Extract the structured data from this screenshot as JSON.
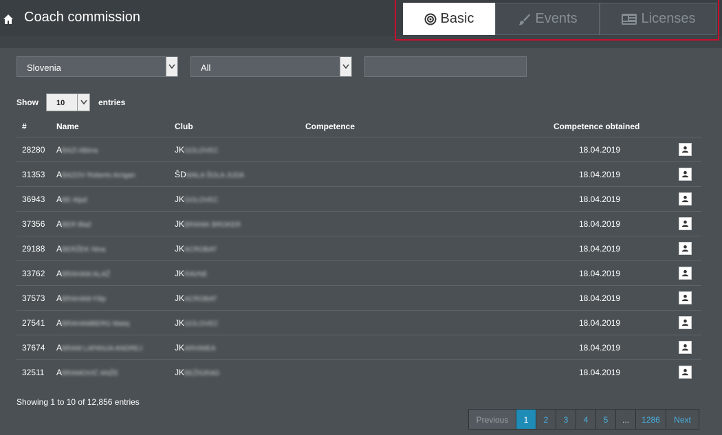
{
  "header": {
    "title": "Coach commission",
    "tabs": [
      {
        "label": "Basic",
        "active": true
      },
      {
        "label": "Events",
        "active": false
      },
      {
        "label": "Licenses",
        "active": false
      }
    ]
  },
  "filters": {
    "country": "Slovenia",
    "category": "All",
    "search_value": ""
  },
  "length": {
    "show_label": "Show",
    "value": "10",
    "entries_label": "entries"
  },
  "table": {
    "columns": [
      "#",
      "Name",
      "Club",
      "Competence",
      "Competence obtained"
    ],
    "rows": [
      {
        "id": "28280",
        "name_initial": "A",
        "name_rest": "BAZI Albina",
        "club_initial": "JK",
        "club_rest": "GOLOVEC",
        "date": "18.04.2019"
      },
      {
        "id": "31353",
        "name_initial": "A",
        "name_rest": "BAZOV Roberto Arrigan",
        "club_initial": "ŠD",
        "club_rest": "MALA ŠOLA JUDA",
        "date": "18.04.2019"
      },
      {
        "id": "36943",
        "name_initial": "A",
        "name_rest": "BE Aljaž",
        "club_initial": "JK",
        "club_rest": "GOLOVEC",
        "date": "18.04.2019"
      },
      {
        "id": "37356",
        "name_initial": "A",
        "name_rest": "BER Blaž",
        "club_initial": "JK",
        "club_rest": "BRANIK BROKER",
        "date": "18.04.2019"
      },
      {
        "id": "29188",
        "name_initial": "A",
        "name_rest": "BERŽEK Nina",
        "club_initial": "JK",
        "club_rest": "ACROBAT",
        "date": "18.04.2019"
      },
      {
        "id": "33762",
        "name_initial": "A",
        "name_rest": "BRAHAM ALAŽ",
        "club_initial": "JK",
        "club_rest": "RAVNE",
        "date": "18.04.2019"
      },
      {
        "id": "37573",
        "name_initial": "A",
        "name_rest": "BRAHAM Filip",
        "club_initial": "JK",
        "club_rest": "ACROBAT",
        "date": "18.04.2019"
      },
      {
        "id": "27541",
        "name_initial": "A",
        "name_rest": "BRAHAMBERG Matej",
        "club_initial": "JK",
        "club_rest": "GOLOVEC",
        "date": "18.04.2019"
      },
      {
        "id": "37674",
        "name_initial": "A",
        "name_rest": "BRAM LAPANJA ANDREJ",
        "club_initial": "JK",
        "club_rest": "ARHIMEA",
        "date": "18.04.2019"
      },
      {
        "id": "32511",
        "name_initial": "A",
        "name_rest": "BRAMOVIĆ ANŽE",
        "club_initial": "JK",
        "club_rest": "BEŽIGRAD",
        "date": "18.04.2019"
      }
    ]
  },
  "footer": {
    "info": "Showing 1 to 10 of 12,856 entries",
    "pagination": {
      "previous": "Previous",
      "pages": [
        "1",
        "2",
        "3",
        "4",
        "5"
      ],
      "ellipsis": "...",
      "last": "1286",
      "next": "Next",
      "current": "1"
    }
  },
  "colors": {
    "accent": "#1f8cb8",
    "highlight_frame": "#c8102e",
    "background": "#4a5054"
  }
}
